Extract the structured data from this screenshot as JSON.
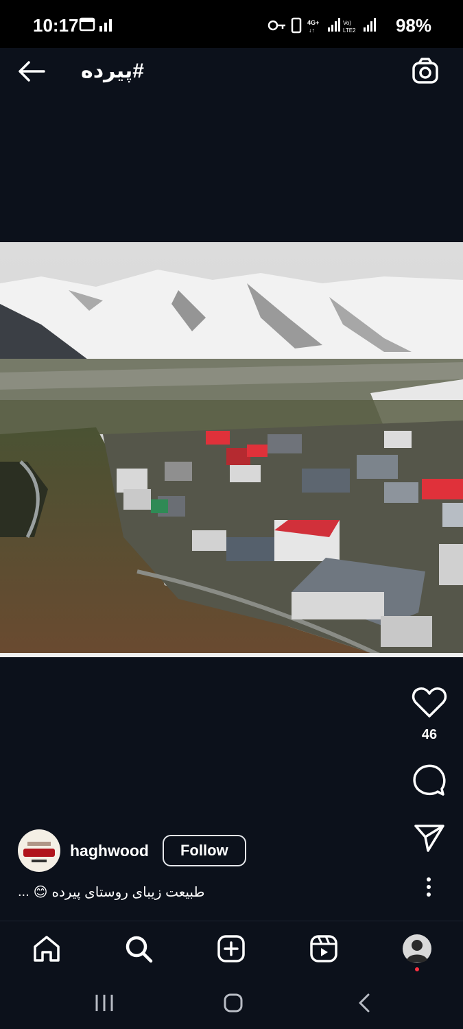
{
  "status": {
    "time": "10:17",
    "battery": "98%"
  },
  "header": {
    "title": "#پیرده"
  },
  "post": {
    "likes": "46",
    "author": "haghwood",
    "follow_label": "Follow",
    "caption": "طبیعت زیبای روستای پیرده",
    "caption_more": "...",
    "emoji": "😊"
  },
  "icons": {
    "back": "back-arrow-icon",
    "camera": "camera-icon",
    "like": "heart-icon",
    "comment": "comment-icon",
    "share": "send-icon",
    "more": "more-vertical-icon"
  },
  "nav": [
    "home",
    "search",
    "create",
    "reels",
    "profile"
  ],
  "colors": {
    "background": "#0c111b",
    "accent": "#ff3040"
  }
}
